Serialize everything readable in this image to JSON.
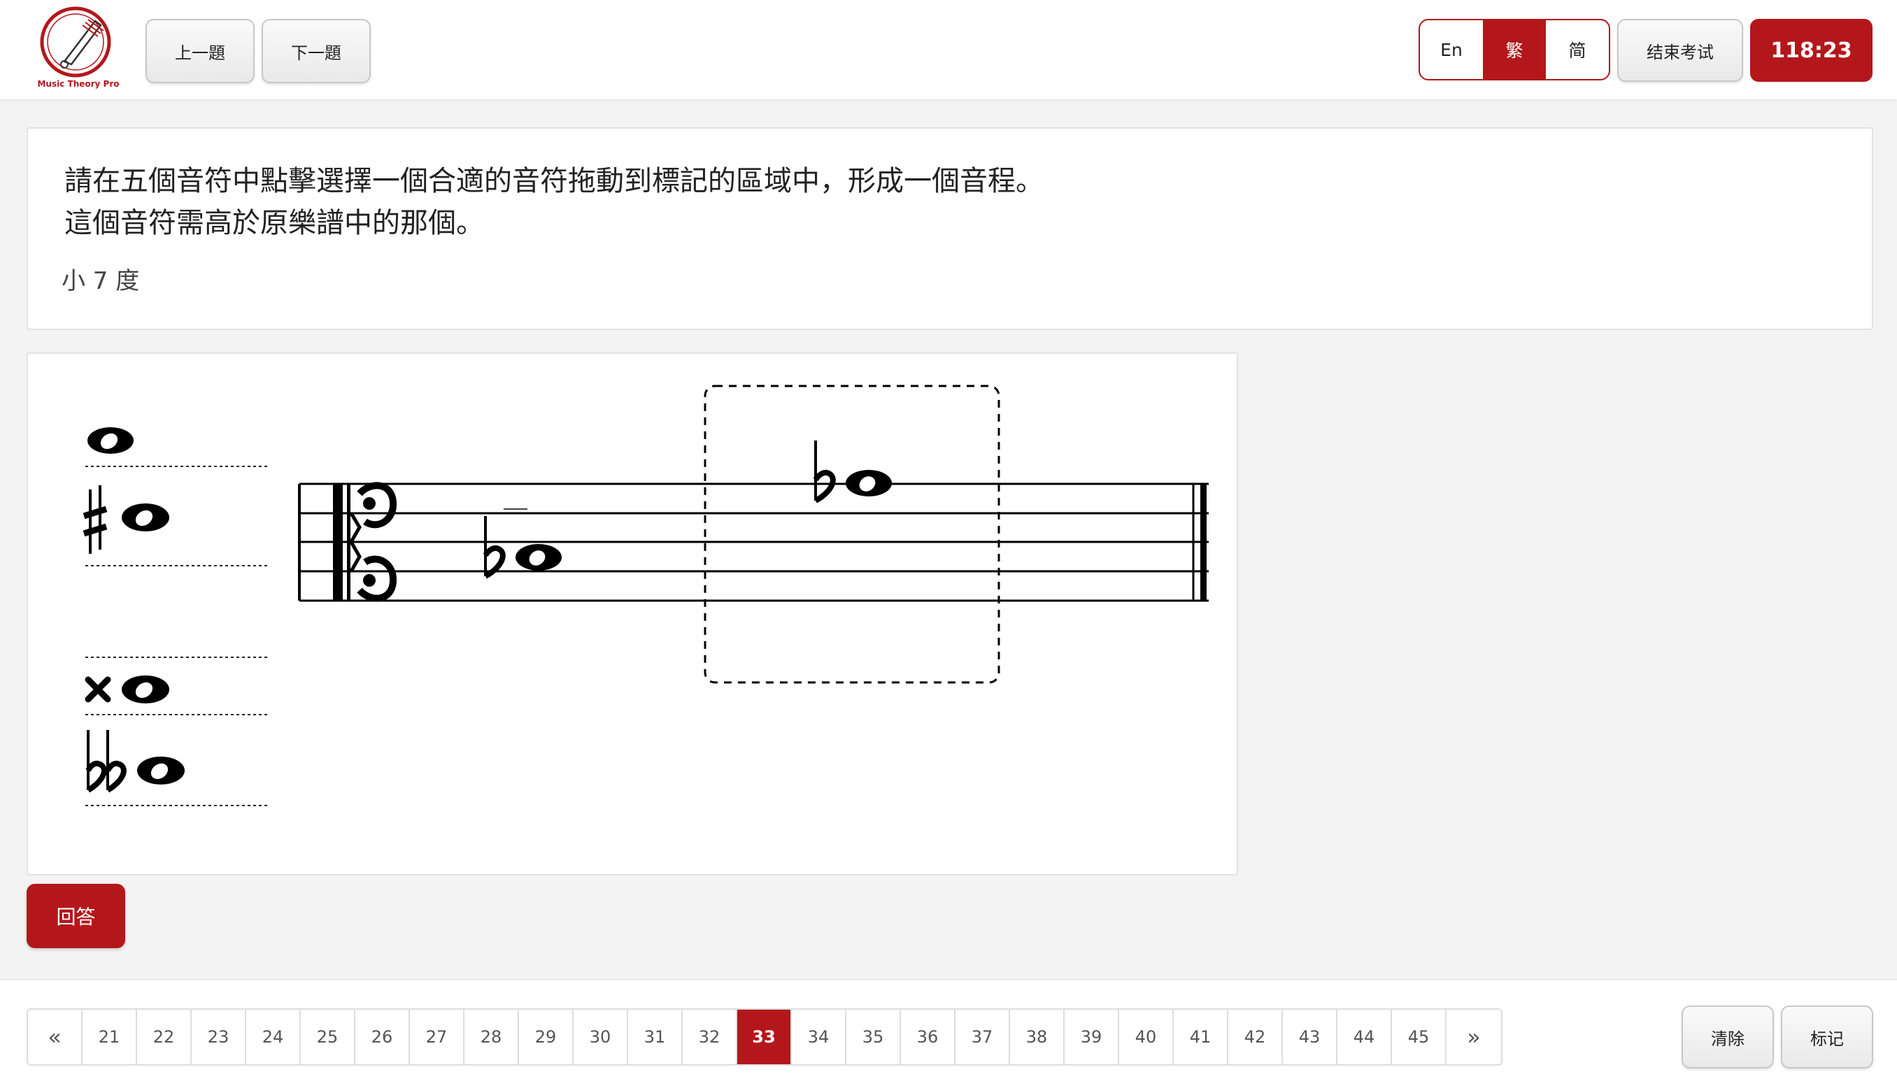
{
  "header": {
    "logo_text": "Music Theory Pro",
    "prev_label": "上一題",
    "next_label": "下一題",
    "languages": [
      {
        "label": "En",
        "active": false
      },
      {
        "label": "繁",
        "active": true
      },
      {
        "label": "简",
        "active": false
      }
    ],
    "end_exam_label": "结束考试",
    "timer": "118:23"
  },
  "question": {
    "line1": "請在五個音符中點擊選擇一個合適的音符拖動到標記的區域中，形成一個音程。",
    "line2": "這個音符需高於原樂譜中的那個。",
    "interval": "小 7 度"
  },
  "palette": {
    "options": [
      {
        "accidental": "none"
      },
      {
        "accidental": "sharp"
      },
      {
        "accidental": "none"
      },
      {
        "accidental": "double-sharp"
      },
      {
        "accidental": "double-flat"
      }
    ]
  },
  "staff": {
    "clef": "alto",
    "given_note": {
      "accidental": "flat"
    },
    "placed_note": {
      "accidental": "flat"
    }
  },
  "answer_label": "回答",
  "pager": {
    "prev": "«",
    "next": "»",
    "pages": [
      "21",
      "22",
      "23",
      "24",
      "25",
      "26",
      "27",
      "28",
      "29",
      "30",
      "31",
      "32",
      "33",
      "34",
      "35",
      "36",
      "37",
      "38",
      "39",
      "40",
      "41",
      "42",
      "43",
      "44",
      "45"
    ],
    "current": "33"
  },
  "footer": {
    "clear_label": "清除",
    "mark_label": "标记"
  },
  "colors": {
    "accent": "#b4171b",
    "background": "#f3f3f3"
  }
}
